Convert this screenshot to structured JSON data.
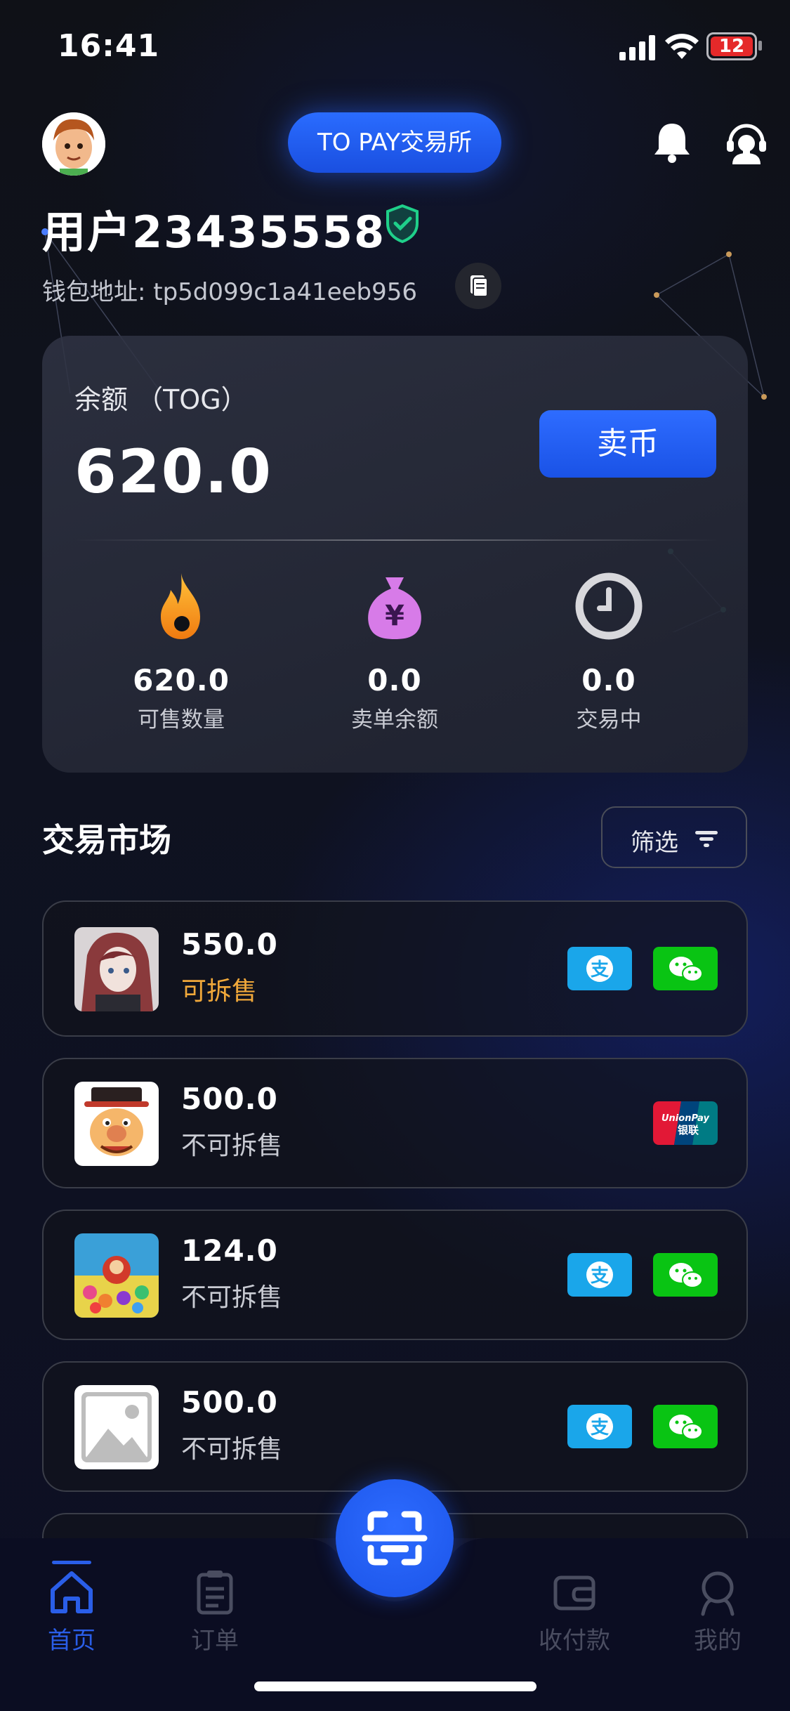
{
  "status_bar": {
    "time": "16:41",
    "battery": "12"
  },
  "header": {
    "exchange_label": "TO PAY交易所"
  },
  "user": {
    "name": "用户23435558",
    "wallet_label": "钱包地址: tp5d099c1a41eeb956"
  },
  "balance": {
    "label": "余额 （TOG）",
    "value": "620.0",
    "sell_label": "卖币",
    "stats": [
      {
        "value": "620.0",
        "label": "可售数量",
        "icon": "flame-icon"
      },
      {
        "value": "0.0",
        "label": "卖单余额",
        "icon": "money-bag-icon"
      },
      {
        "value": "0.0",
        "label": "交易中",
        "icon": "clock-icon"
      }
    ]
  },
  "market": {
    "title": "交易市场",
    "filter_label": "筛选",
    "listings": [
      {
        "amount": "550.0",
        "split": "可拆售",
        "split_color": "#f0a83a",
        "avatar": "anime-avatar",
        "payments": [
          "alipay-icon",
          "wechat-pay-icon"
        ]
      },
      {
        "amount": "500.0",
        "split": "不可拆售",
        "split_color": "#c9cbd3",
        "avatar": "cartoon-avatar",
        "payments": [
          "unionpay-icon"
        ]
      },
      {
        "amount": "124.0",
        "split": "不可拆售",
        "split_color": "#c9cbd3",
        "avatar": "colorful-avatar",
        "payments": [
          "alipay-icon",
          "wechat-pay-icon"
        ]
      },
      {
        "amount": "500.0",
        "split": "不可拆售",
        "split_color": "#c9cbd3",
        "avatar": "image-placeholder-icon",
        "payments": [
          "alipay-icon",
          "wechat-pay-icon"
        ]
      }
    ]
  },
  "nav": {
    "items": [
      {
        "label": "首页",
        "icon": "home-icon",
        "active": true
      },
      {
        "label": "订单",
        "icon": "orders-icon",
        "active": false
      },
      {
        "label": "收付款",
        "icon": "wallet-icon",
        "active": false
      },
      {
        "label": "我的",
        "icon": "profile-icon",
        "active": false
      }
    ],
    "scan": "scan-icon"
  },
  "colors": {
    "accent": "#1f5cf0",
    "orange": "#f0a83a",
    "alipay": "#1aa6ea",
    "wechat": "#09c413",
    "background": "#0f1117"
  }
}
